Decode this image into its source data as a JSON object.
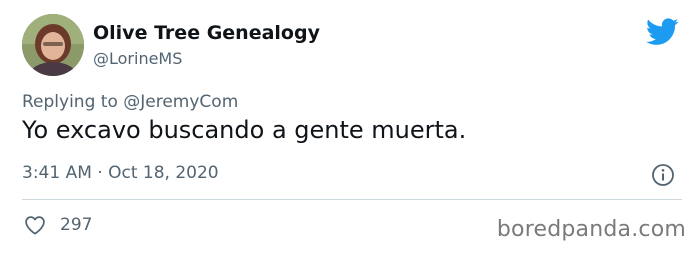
{
  "author": {
    "display_name": "Olive Tree Genealogy",
    "handle": "@LorineMS",
    "avatar_icon": "profile-photo"
  },
  "reply": {
    "prefix": "Replying to",
    "mention": "@JeremyCom"
  },
  "tweet": {
    "text": "Yo excavo buscando a gente muerta.",
    "timestamp": "3:41 AM · Oct 18, 2020"
  },
  "actions": {
    "likes": "297",
    "like_icon": "heart-icon",
    "info_icon": "info-icon"
  },
  "branding": {
    "logo_icon": "twitter-bird-icon",
    "logo_color": "#1d9bf0",
    "watermark": "boredpanda.com"
  },
  "colors": {
    "text_primary": "#0f1419",
    "text_secondary": "#536471",
    "divider": "#cfd9de"
  }
}
